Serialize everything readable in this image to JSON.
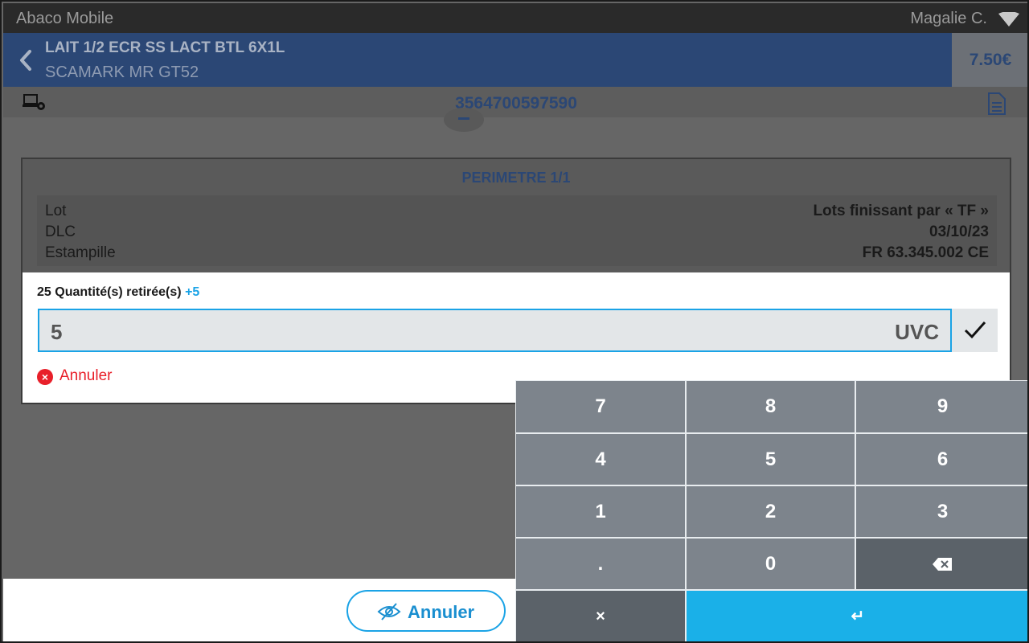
{
  "status_bar": {
    "app_name": "Abaco Mobile",
    "user": "Magalie C."
  },
  "header": {
    "title": "LAIT 1/2 ECR SS LACT BTL 6X1L",
    "subtitle": "SCAMARK MR GT52",
    "price": "7.50€"
  },
  "barcode": "3564700597590",
  "dialog": {
    "title": "PERIMETRE 1/1",
    "info": [
      {
        "label": "Lot",
        "value": "Lots finissant par « TF »"
      },
      {
        "label": "DLC",
        "value": "03/10/23"
      },
      {
        "label": "Estampille",
        "value": "FR 63.345.002 CE"
      }
    ],
    "quantity_text": "25 Quantité(s) retirée(s)",
    "quantity_delta": "+5",
    "input_value": "5",
    "input_unit": "UVC",
    "cancel_label": "Annuler"
  },
  "bottom": {
    "cancel_label": "Annuler"
  },
  "keypad": {
    "keys": [
      "7",
      "8",
      "9",
      "4",
      "5",
      "6",
      "1",
      "2",
      "3",
      ".",
      "0"
    ],
    "close_key": "×",
    "enter_key": "↵"
  },
  "colors": {
    "accent": "#1aa3e6",
    "header_bg": "#2b4775",
    "danger": "#e8202a"
  },
  "icons": {
    "wifi": "wifi-icon",
    "back": "chevron-left-icon",
    "device": "device-eye-icon",
    "document": "document-icon",
    "confirm": "check-icon",
    "cancel": "close-circle-icon",
    "hide": "eye-slash-icon",
    "backspace": "backspace-icon"
  }
}
